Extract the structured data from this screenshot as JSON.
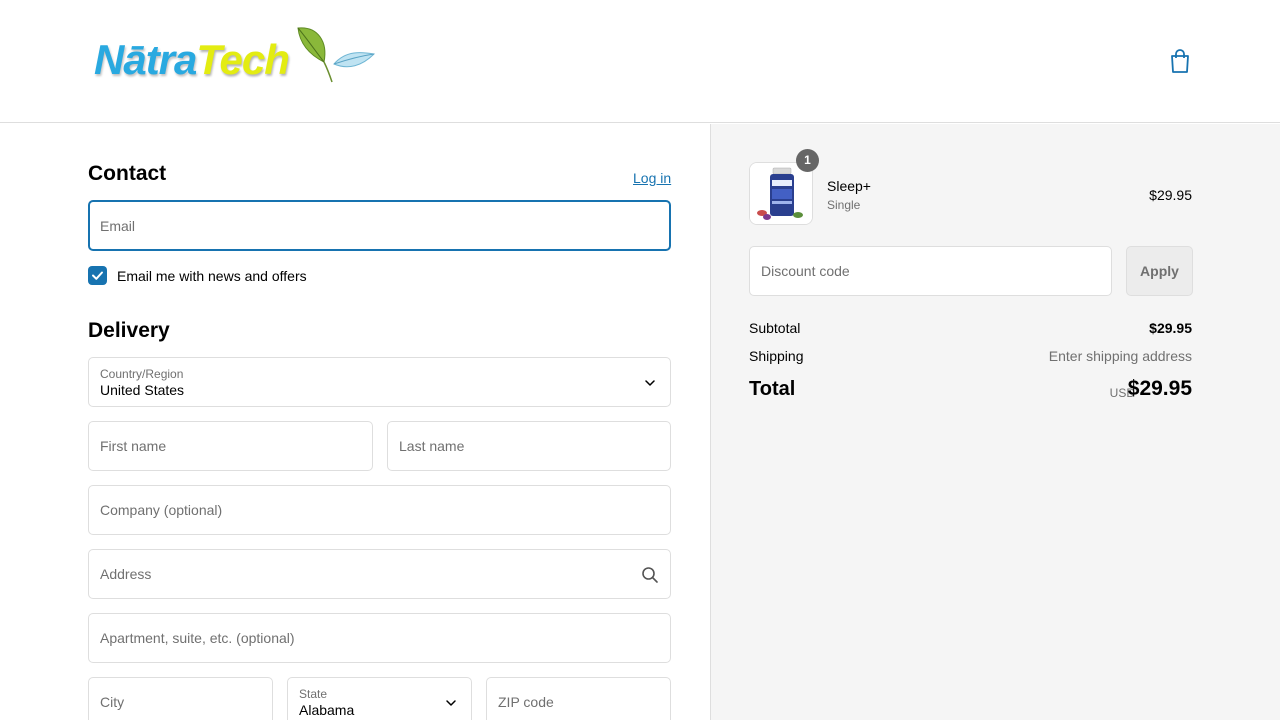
{
  "header": {
    "logo": {
      "text_part1": "Nātra",
      "text_part2": "Tech"
    },
    "cart_icon": "shopping-bag-icon"
  },
  "contact": {
    "title": "Contact",
    "login_label": "Log in",
    "email_placeholder": "Email",
    "newsletter_label": "Email me with news and offers",
    "newsletter_checked": true
  },
  "delivery": {
    "title": "Delivery",
    "country_label": "Country/Region",
    "country_value": "United States",
    "first_name_placeholder": "First name",
    "last_name_placeholder": "Last name",
    "company_placeholder": "Company (optional)",
    "address_placeholder": "Address",
    "apartment_placeholder": "Apartment, suite, etc. (optional)",
    "city_placeholder": "City",
    "state_label": "State",
    "state_value": "Alabama",
    "zip_placeholder": "ZIP code"
  },
  "summary": {
    "product": {
      "quantity": "1",
      "name": "Sleep+",
      "variant": "Single",
      "price": "$29.95"
    },
    "discount_placeholder": "Discount code",
    "apply_label": "Apply",
    "subtotal_label": "Subtotal",
    "subtotal_value": "$29.95",
    "shipping_label": "Shipping",
    "shipping_value": "Enter shipping address",
    "total_label": "Total",
    "total_currency": "USD",
    "total_value": "$29.95"
  },
  "colors": {
    "accent": "#1773b0",
    "logo_blue": "#29a9e0",
    "logo_yellow": "#e3ec12",
    "summary_bg": "#f5f5f5"
  }
}
